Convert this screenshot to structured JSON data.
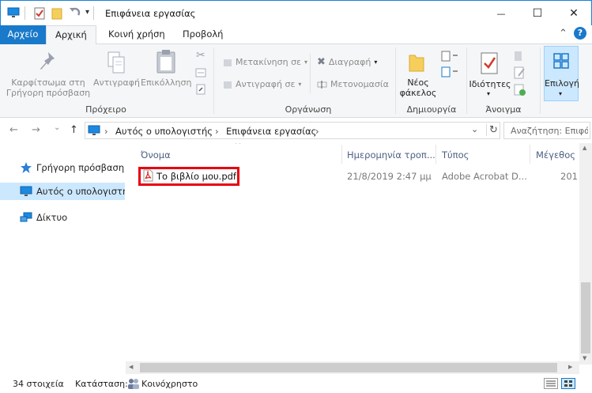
{
  "window": {
    "title": "Επιφάνεια εργασίας",
    "minimize_glyph": "—",
    "maximize_glyph": "☐",
    "close_glyph": "✕"
  },
  "quick_access_toolbar": {
    "icons": [
      "computer-icon",
      "properties-check-icon",
      "new-folder-icon",
      "undo-icon",
      "customize-dropdown-icon"
    ],
    "dropdown_glyph": "▾"
  },
  "ribbon_tabs": [
    {
      "label": "Αρχείο",
      "active": false
    },
    {
      "label": "Αρχική",
      "active": true
    },
    {
      "label": "Κοινή χρήση",
      "active": false
    },
    {
      "label": "Προβολή",
      "active": false
    }
  ],
  "ribbon": {
    "collapse_glyph": "⌃",
    "help_glyph": "?",
    "clipboard": {
      "pin_label": "Καρφίτσωμα στη Γρήγορη πρόσβαση",
      "copy_label": "Αντιγραφή",
      "paste_label": "Επικόλληση",
      "group_label": "Πρόχειρο"
    },
    "organize": {
      "move_to_label": "Μετακίνηση σε",
      "copy_to_label": "Αντιγραφή σε",
      "delete_label": "Διαγραφή",
      "rename_label": "Μετονομασία",
      "group_label": "Οργάνωση"
    },
    "new": {
      "new_folder_label": "Νέος φάκελος",
      "group_label": "Δημιουργία"
    },
    "open": {
      "properties_label": "Ιδιότητες",
      "group_label": "Άνοιγμα"
    },
    "select": {
      "select_label": "Επιλογή"
    }
  },
  "address_bar": {
    "back_glyph": "←",
    "forward_glyph": "→",
    "recent_glyph": "⌄",
    "up_glyph": "↑",
    "crumbs": [
      "Αυτός ο υπολογιστής",
      "Επιφάνεια εργασίας"
    ],
    "separator_glyph": "›",
    "refresh_glyph": "↻",
    "search_placeholder": "Αναζήτηση: Επιφάνεια εργασίας"
  },
  "nav_pane": {
    "items": [
      {
        "label": "Γρήγορη πρόσβαση",
        "icon": "star-icon",
        "selected": false
      },
      {
        "label": "Αυτός ο υπολογιστής",
        "icon": "computer-icon",
        "selected": true
      },
      {
        "label": "Δίκτυο",
        "icon": "network-icon",
        "selected": false
      }
    ]
  },
  "file_list": {
    "columns": [
      "Όνομα",
      "Ημερομηνία τροπ...",
      "Τύπος",
      "Μέγεθος"
    ],
    "sort_glyph": "^",
    "rows": [
      {
        "name": "Το βιβλίο μου.pdf",
        "date": "21/8/2019 2:47 μμ",
        "type": "Adobe Acrobat D...",
        "size": "201",
        "icon": "pdf-icon"
      }
    ]
  },
  "scrollbars": {
    "up_glyph": "▲",
    "down_glyph": "▼",
    "left_glyph": "◀",
    "right_glyph": "▶"
  },
  "status_bar": {
    "item_count": "34 στοιχεία",
    "state_label": "Κατάσταση:",
    "state_value": "Κοινόχρηστο"
  },
  "colors": {
    "accent": "#1979ca",
    "selection": "#cce8ff",
    "highlight_border": "#e8000f"
  }
}
